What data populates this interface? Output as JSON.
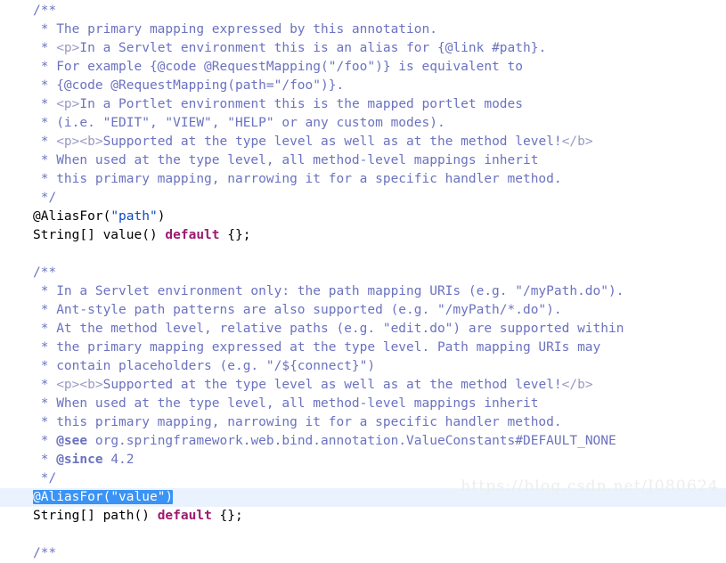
{
  "editor": {
    "language": "java",
    "background_color": "#ffffff",
    "caret_line_color": "#eaf3fd",
    "selection_color": "#3a93f5",
    "comment_color": "#6b72c0",
    "string_color": "#0d46c8",
    "keyword_color": "#9c1a6e",
    "plain_color": "#000000"
  },
  "watermark": {
    "text": "https://blog.csdn.net/J080624"
  },
  "lines": [
    {
      "id": "l1",
      "indent": 0,
      "tokens": [
        {
          "t": "/**",
          "c": "cm"
        }
      ]
    },
    {
      "id": "l2",
      "indent": 0,
      "tokens": [
        {
          "t": " * The primary mapping expressed by this annotation.",
          "c": "cm"
        }
      ]
    },
    {
      "id": "l3",
      "indent": 0,
      "tokens": [
        {
          "t": " * ",
          "c": "cm"
        },
        {
          "t": "<p>",
          "c": "html"
        },
        {
          "t": "In a Servlet environment this is an alias for {@link #path}.",
          "c": "cm"
        }
      ]
    },
    {
      "id": "l4",
      "indent": 0,
      "tokens": [
        {
          "t": " * For example {@code @RequestMapping(\"/foo\")} is equivalent to",
          "c": "cm"
        }
      ]
    },
    {
      "id": "l5",
      "indent": 0,
      "tokens": [
        {
          "t": " * {@code @RequestMapping(path=\"/foo\")}.",
          "c": "cm"
        }
      ]
    },
    {
      "id": "l6",
      "indent": 0,
      "tokens": [
        {
          "t": " * ",
          "c": "cm"
        },
        {
          "t": "<p>",
          "c": "html"
        },
        {
          "t": "In a Portlet environment this is the mapped portlet modes",
          "c": "cm"
        }
      ]
    },
    {
      "id": "l7",
      "indent": 0,
      "tokens": [
        {
          "t": " * (i.e. \"EDIT\", \"VIEW\", \"HELP\" or any custom modes).",
          "c": "cm"
        }
      ]
    },
    {
      "id": "l8",
      "indent": 0,
      "tokens": [
        {
          "t": " * ",
          "c": "cm"
        },
        {
          "t": "<p><b>",
          "c": "html"
        },
        {
          "t": "Supported at the type level as well as at the method level!",
          "c": "cm"
        },
        {
          "t": "</b>",
          "c": "html"
        }
      ]
    },
    {
      "id": "l9",
      "indent": 0,
      "tokens": [
        {
          "t": " * When used at the type level, all method-level mappings inherit",
          "c": "cm"
        }
      ]
    },
    {
      "id": "l10",
      "indent": 0,
      "tokens": [
        {
          "t": " * this primary mapping, narrowing it for a specific handler method.",
          "c": "cm"
        }
      ]
    },
    {
      "id": "l11",
      "indent": 0,
      "tokens": [
        {
          "t": " */",
          "c": "cm"
        }
      ]
    },
    {
      "id": "l12",
      "indent": 0,
      "tokens": [
        {
          "t": "@AliasFor(",
          "c": "pl"
        },
        {
          "t": "\"path\"",
          "c": "str"
        },
        {
          "t": ")",
          "c": "pl"
        }
      ]
    },
    {
      "id": "l13",
      "indent": 0,
      "tokens": [
        {
          "t": "String[] value() ",
          "c": "pl"
        },
        {
          "t": "default",
          "c": "kw"
        },
        {
          "t": " {};",
          "c": "pl"
        }
      ]
    },
    {
      "id": "l14",
      "indent": 0,
      "tokens": [
        {
          "t": " ",
          "c": "pl"
        }
      ]
    },
    {
      "id": "l15",
      "indent": 0,
      "tokens": [
        {
          "t": "/**",
          "c": "cm"
        }
      ]
    },
    {
      "id": "l16",
      "indent": 0,
      "tokens": [
        {
          "t": " * In a Servlet environment only: the path mapping URIs (e.g. \"/myPath.do\").",
          "c": "cm"
        }
      ]
    },
    {
      "id": "l17",
      "indent": 0,
      "tokens": [
        {
          "t": " * Ant-style path patterns are also supported (e.g. \"/myPath/*.do\").",
          "c": "cm"
        }
      ]
    },
    {
      "id": "l18",
      "indent": 0,
      "tokens": [
        {
          "t": " * At the method level, relative paths (e.g. \"edit.do\") are supported within",
          "c": "cm"
        }
      ]
    },
    {
      "id": "l19",
      "indent": 0,
      "tokens": [
        {
          "t": " * the primary mapping expressed at the type level. Path mapping URIs may",
          "c": "cm"
        }
      ]
    },
    {
      "id": "l20",
      "indent": 0,
      "tokens": [
        {
          "t": " * contain placeholders (e.g. \"/${connect}\")",
          "c": "cm"
        }
      ]
    },
    {
      "id": "l21",
      "indent": 0,
      "tokens": [
        {
          "t": " * ",
          "c": "cm"
        },
        {
          "t": "<p><b>",
          "c": "html"
        },
        {
          "t": "Supported at the type level as well as at the method level!",
          "c": "cm"
        },
        {
          "t": "</b>",
          "c": "html"
        }
      ]
    },
    {
      "id": "l22",
      "indent": 0,
      "tokens": [
        {
          "t": " * When used at the type level, all method-level mappings inherit",
          "c": "cm"
        }
      ]
    },
    {
      "id": "l23",
      "indent": 0,
      "tokens": [
        {
          "t": " * this primary mapping, narrowing it for a specific handler method.",
          "c": "cm"
        }
      ]
    },
    {
      "id": "l24",
      "indent": 0,
      "tokens": [
        {
          "t": " * ",
          "c": "cm"
        },
        {
          "t": "@see",
          "c": "cmt"
        },
        {
          "t": " org.springframework.web.bind.annotation.ValueConstants#DEFAULT_NONE",
          "c": "cm"
        }
      ]
    },
    {
      "id": "l25",
      "indent": 0,
      "tokens": [
        {
          "t": " * ",
          "c": "cm"
        },
        {
          "t": "@since",
          "c": "cmt"
        },
        {
          "t": " 4.2",
          "c": "cm"
        }
      ]
    },
    {
      "id": "l26",
      "indent": 0,
      "tokens": [
        {
          "t": " */",
          "c": "cm"
        }
      ]
    },
    {
      "id": "l27",
      "indent": 0,
      "caret": true,
      "selected": true,
      "tokens": [
        {
          "t": "@AliasFor(",
          "c": "pl"
        },
        {
          "t": "\"value\"",
          "c": "str"
        },
        {
          "t": ")",
          "c": "pl"
        }
      ]
    },
    {
      "id": "l28",
      "indent": 0,
      "tokens": [
        {
          "t": "String[] path() ",
          "c": "pl"
        },
        {
          "t": "default",
          "c": "kw"
        },
        {
          "t": " {};",
          "c": "pl"
        }
      ]
    },
    {
      "id": "l29",
      "indent": 0,
      "tokens": [
        {
          "t": " ",
          "c": "pl"
        }
      ]
    },
    {
      "id": "l30",
      "indent": 0,
      "tokens": [
        {
          "t": "/**",
          "c": "cm"
        }
      ]
    }
  ]
}
